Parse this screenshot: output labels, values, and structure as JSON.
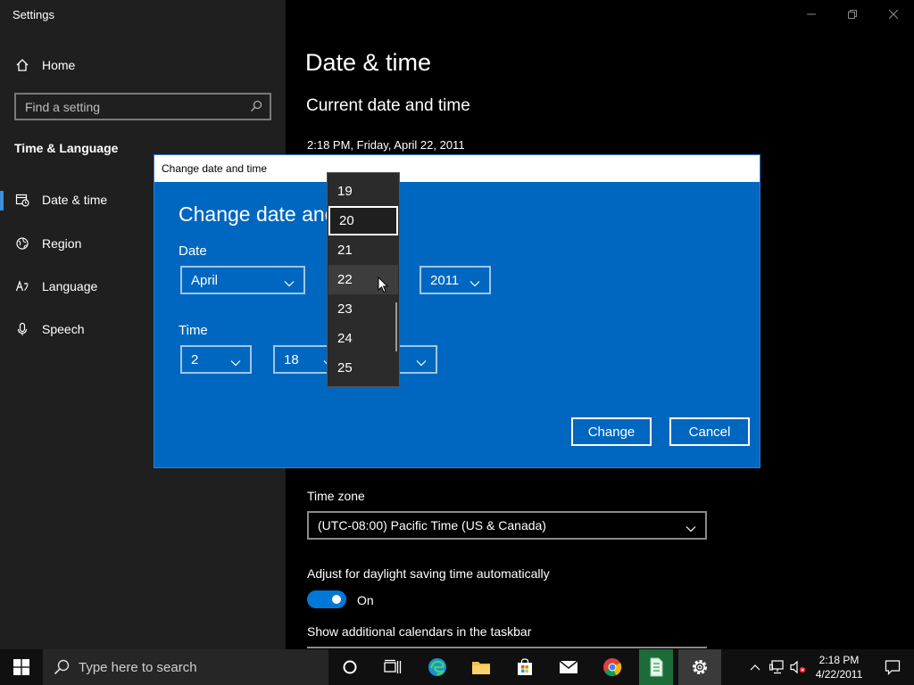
{
  "app_title": "Settings",
  "sidebar": {
    "home_label": "Home",
    "search_placeholder": "Find a setting",
    "section_heading": "Time & Language",
    "items": [
      {
        "label": "Date & time",
        "icon": "date-time-icon"
      },
      {
        "label": "Region",
        "icon": "globe-icon"
      },
      {
        "label": "Language",
        "icon": "language-icon"
      },
      {
        "label": "Speech",
        "icon": "microphone-icon"
      }
    ]
  },
  "main": {
    "title": "Date & time",
    "current_heading": "Current date and time",
    "current_value": "2:18 PM, Friday, April 22, 2011",
    "time_zone_label": "Time zone",
    "time_zone_value": "(UTC-08:00) Pacific Time (US & Canada)",
    "dst_label": "Adjust for daylight saving time automatically",
    "dst_state": "On",
    "calendars_label": "Show additional calendars in the taskbar"
  },
  "dialog": {
    "window_title": "Change date and time",
    "heading": "Change date and",
    "date_label": "Date",
    "month": "April",
    "year": "2011",
    "time_label": "Time",
    "hour": "2",
    "minute": "18",
    "day_options": [
      "19",
      "20",
      "21",
      "22",
      "23",
      "24",
      "25"
    ],
    "selected_day": "20",
    "hovered_day": "22",
    "change_button": "Change",
    "cancel_button": "Cancel"
  },
  "taskbar": {
    "search_placeholder": "Type here to search",
    "clock_time": "2:18 PM",
    "clock_date": "4/22/2011"
  },
  "colors": {
    "accent": "#0078d7",
    "dialog_bg": "#0067c0",
    "sidebar_bg": "#1f1f1f"
  }
}
